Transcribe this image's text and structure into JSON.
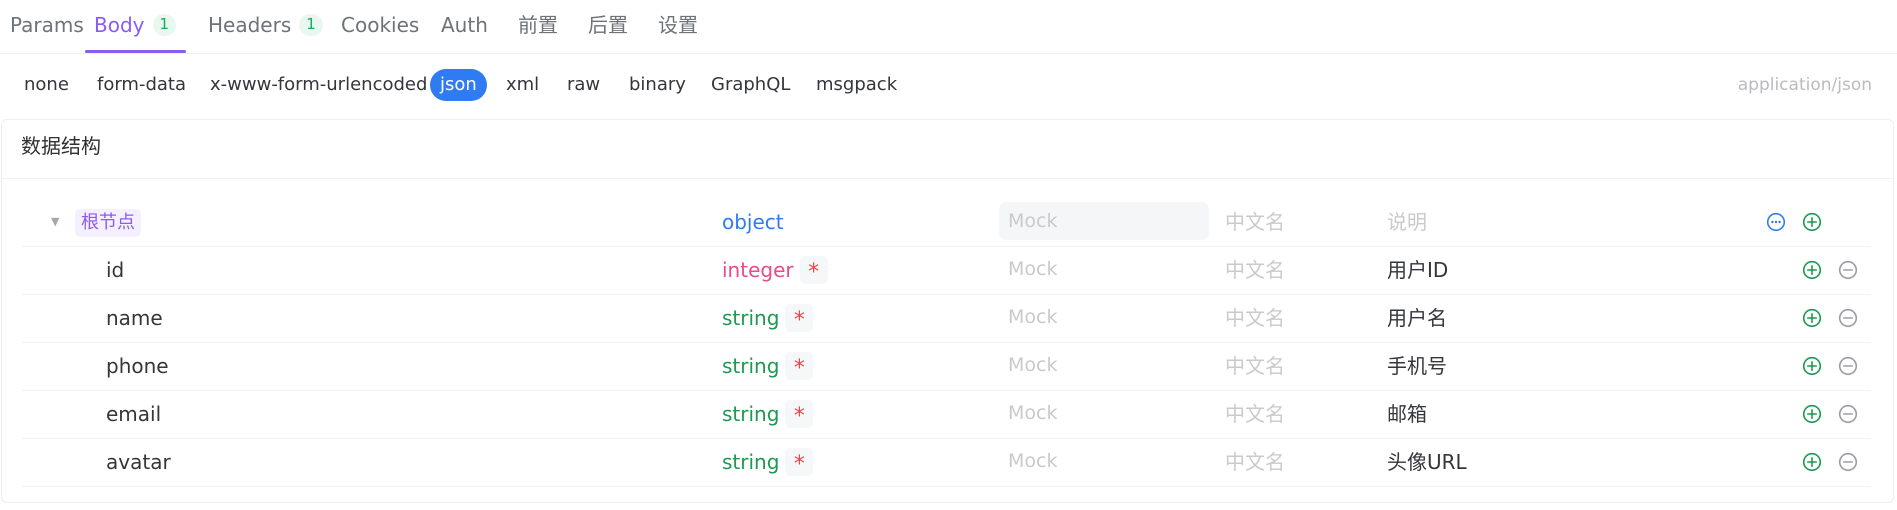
{
  "tabs": [
    {
      "label": "Params",
      "badge": null,
      "active": false
    },
    {
      "label": "Body",
      "badge": "1",
      "active": true
    },
    {
      "label": "Headers",
      "badge": "1",
      "active": false
    },
    {
      "label": "Cookies",
      "badge": null,
      "active": false
    },
    {
      "label": "Auth",
      "badge": null,
      "active": false
    },
    {
      "label": "前置",
      "badge": null,
      "active": false
    },
    {
      "label": "后置",
      "badge": null,
      "active": false
    },
    {
      "label": "设置",
      "badge": null,
      "active": false
    }
  ],
  "body_types": [
    {
      "label": "none",
      "active": false
    },
    {
      "label": "form-data",
      "active": false
    },
    {
      "label": "x-www-form-urlencoded",
      "active": false
    },
    {
      "label": "json",
      "active": true
    },
    {
      "label": "xml",
      "active": false
    },
    {
      "label": "raw",
      "active": false
    },
    {
      "label": "binary",
      "active": false
    },
    {
      "label": "GraphQL",
      "active": false
    },
    {
      "label": "msgpack",
      "active": false
    }
  ],
  "content_type": "application/json",
  "schema": {
    "title": "数据结构",
    "root": {
      "label": "根节点",
      "type": "object",
      "mock_placeholder": "Mock",
      "cn_name_placeholder": "中文名",
      "description_placeholder": "说明"
    },
    "fields": [
      {
        "name": "id",
        "type": "integer",
        "required_mark": "*",
        "mock_placeholder": "Mock",
        "cn_name_placeholder": "中文名",
        "description": "用户ID"
      },
      {
        "name": "name",
        "type": "string",
        "required_mark": "*",
        "mock_placeholder": "Mock",
        "cn_name_placeholder": "中文名",
        "description": "用户名"
      },
      {
        "name": "phone",
        "type": "string",
        "required_mark": "*",
        "mock_placeholder": "Mock",
        "cn_name_placeholder": "中文名",
        "description": "手机号"
      },
      {
        "name": "email",
        "type": "string",
        "required_mark": "*",
        "mock_placeholder": "Mock",
        "cn_name_placeholder": "中文名",
        "description": "邮箱"
      },
      {
        "name": "avatar",
        "type": "string",
        "required_mark": "*",
        "mock_placeholder": "Mock",
        "cn_name_placeholder": "中文名",
        "description": "头像URL"
      }
    ]
  },
  "colors": {
    "accent_purple": "#8a5cf0",
    "json_active_blue": "#2f7bf3",
    "object_type": "#2f7bf3",
    "integer_type": "#e84a8d",
    "string_type": "#1d9a52",
    "required_red": "#e5484d",
    "add_green": "#1d9a52"
  },
  "icons": {
    "caret": "caret-down-icon",
    "more": "more-circle-icon",
    "add": "plus-circle-icon",
    "remove": "minus-circle-icon"
  }
}
